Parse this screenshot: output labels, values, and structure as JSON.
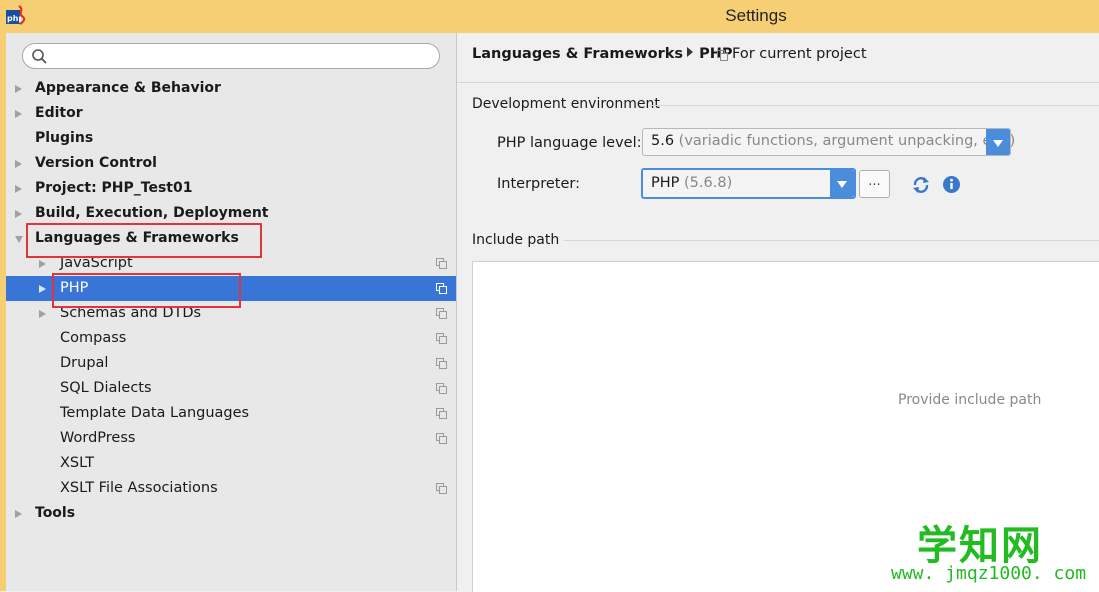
{
  "window": {
    "title": "Settings"
  },
  "search": {
    "placeholder": ""
  },
  "tree": [
    {
      "label": "Appearance & Behavior",
      "bold": true,
      "indent": 0,
      "arrow": "right",
      "copy": false
    },
    {
      "label": "Editor",
      "bold": true,
      "indent": 0,
      "arrow": "right",
      "copy": false
    },
    {
      "label": "Plugins",
      "bold": true,
      "indent": 0,
      "arrow": "none",
      "copy": false
    },
    {
      "label": "Version Control",
      "bold": true,
      "indent": 0,
      "arrow": "right",
      "copy": false
    },
    {
      "label": "Project: PHP_Test01",
      "bold": true,
      "indent": 0,
      "arrow": "right",
      "copy": false
    },
    {
      "label": "Build, Execution, Deployment",
      "bold": true,
      "indent": 0,
      "arrow": "right",
      "copy": false
    },
    {
      "label": "Languages & Frameworks",
      "bold": true,
      "indent": 0,
      "arrow": "down",
      "copy": false
    },
    {
      "label": "JavaScript",
      "bold": false,
      "indent": 1,
      "arrow": "right",
      "copy": true
    },
    {
      "label": "PHP",
      "bold": false,
      "indent": 1,
      "arrow": "right",
      "copy": true,
      "selected": true
    },
    {
      "label": "Schemas and DTDs",
      "bold": false,
      "indent": 1,
      "arrow": "right",
      "copy": true
    },
    {
      "label": "Compass",
      "bold": false,
      "indent": 1,
      "arrow": "none",
      "copy": true
    },
    {
      "label": "Drupal",
      "bold": false,
      "indent": 1,
      "arrow": "none",
      "copy": true
    },
    {
      "label": "SQL Dialects",
      "bold": false,
      "indent": 1,
      "arrow": "none",
      "copy": true
    },
    {
      "label": "Template Data Languages",
      "bold": false,
      "indent": 1,
      "arrow": "none",
      "copy": true
    },
    {
      "label": "WordPress",
      "bold": false,
      "indent": 1,
      "arrow": "none",
      "copy": true
    },
    {
      "label": "XSLT",
      "bold": false,
      "indent": 1,
      "arrow": "none",
      "copy": false
    },
    {
      "label": "XSLT File Associations",
      "bold": false,
      "indent": 1,
      "arrow": "none",
      "copy": true
    },
    {
      "label": "Tools",
      "bold": true,
      "indent": 0,
      "arrow": "right",
      "copy": false
    }
  ],
  "breadcrumb": {
    "parent": "Languages & Frameworks",
    "current": "PHP",
    "scope": "For current project"
  },
  "dev_env": {
    "heading": "Development environment",
    "language_level_label": "PHP language level:",
    "language_level_value": "5.6",
    "language_level_hint": "(variadic functions, argument unpacking, etc.)",
    "interpreter_label": "Interpreter:",
    "interpreter_value": "PHP",
    "interpreter_version": "(5.6.8)",
    "more_button": "..."
  },
  "include_path": {
    "heading": "Include path",
    "empty_text": "Provide include path"
  },
  "watermark": {
    "title": "学知网",
    "url": "www. jmqz1000. com"
  },
  "colors": {
    "titlebar": "#f6cf74",
    "selection": "#3875d7",
    "accent": "#4a8ddb",
    "highlight_box": "#e0353b"
  }
}
